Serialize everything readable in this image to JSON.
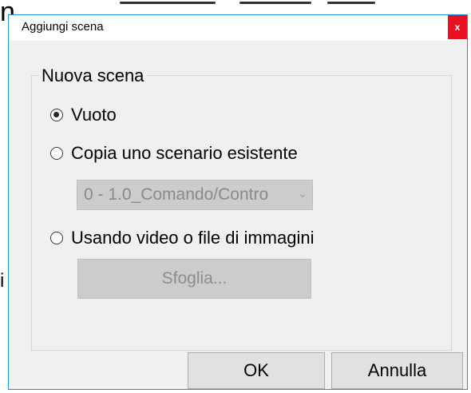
{
  "background": {
    "letter_top": "n",
    "letter_mid": "i"
  },
  "dialog": {
    "title": "Aggiungi scena",
    "close_label": "x",
    "close_color": "#e81123",
    "border_color": "#1e90d8",
    "group": {
      "legend": "Nuova scena",
      "options": [
        {
          "label": "Vuoto",
          "checked": true
        },
        {
          "label": "Copia uno scenario esistente",
          "checked": false
        },
        {
          "label": "Usando video o file di immagini",
          "checked": false
        }
      ],
      "scenario_select": {
        "value": "0 - 1.0_Comando/Contro",
        "arrow_icon": "chevron-down-icon",
        "enabled": false
      },
      "browse_label": "Sfoglia..."
    },
    "buttons": {
      "ok_label": "OK",
      "cancel_label": "Annulla"
    }
  }
}
